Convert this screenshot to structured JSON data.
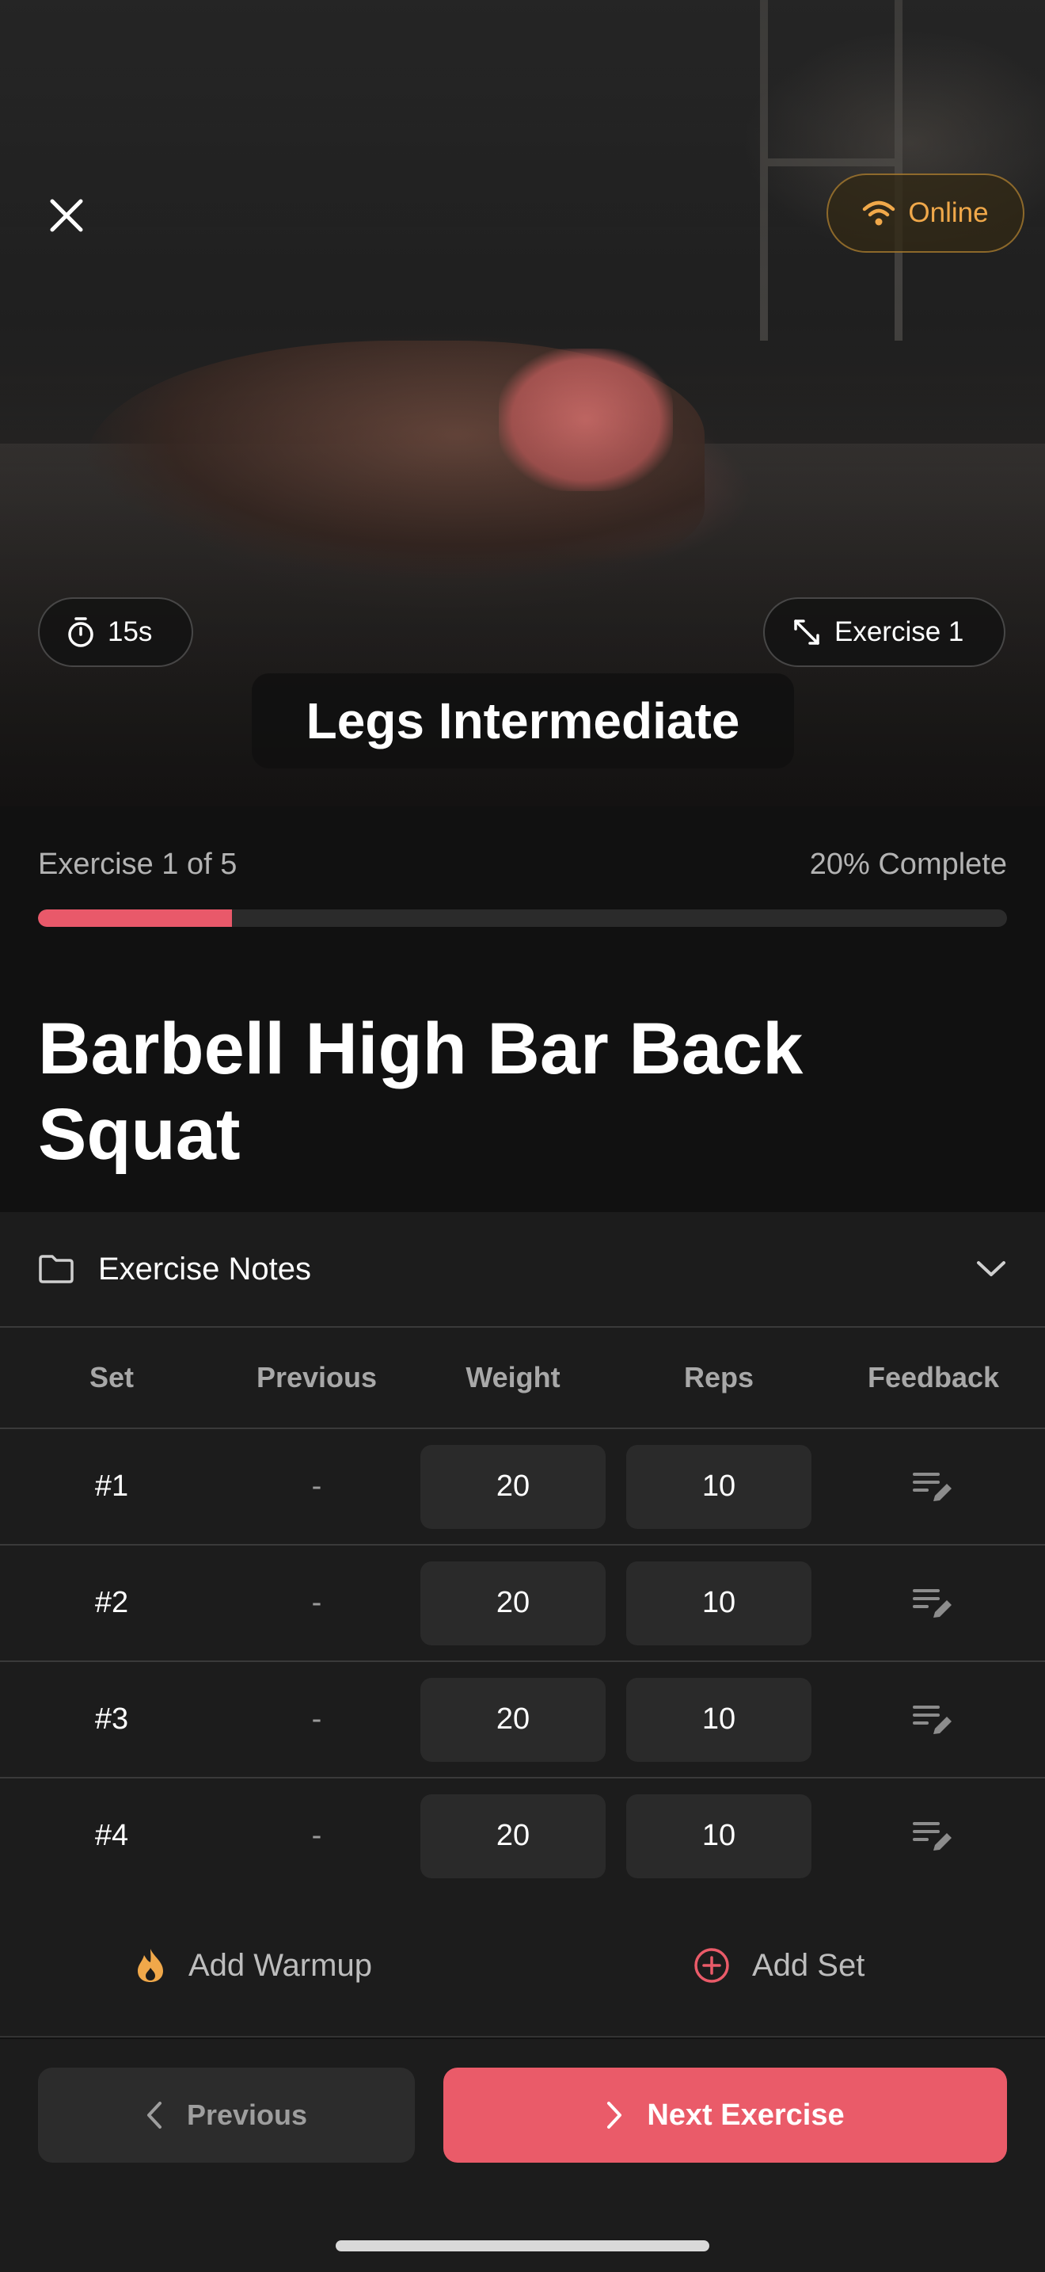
{
  "hero": {
    "status": "Online",
    "timer": "15s",
    "exercise_badge": "Exercise 1",
    "workout_title": "Legs Intermediate"
  },
  "progress": {
    "label": "Exercise 1 of 5",
    "complete_label": "20% Complete",
    "fraction": 0.2
  },
  "exercise": {
    "title": "Barbell High Bar Back Squat"
  },
  "notes": {
    "label": "Exercise Notes"
  },
  "table": {
    "headers": {
      "set": "Set",
      "previous": "Previous",
      "weight": "Weight",
      "reps": "Reps",
      "feedback": "Feedback"
    },
    "rows": [
      {
        "set": "#1",
        "previous": "-",
        "weight": "20",
        "reps": "10"
      },
      {
        "set": "#2",
        "previous": "-",
        "weight": "20",
        "reps": "10"
      },
      {
        "set": "#3",
        "previous": "-",
        "weight": "20",
        "reps": "10"
      },
      {
        "set": "#4",
        "previous": "-",
        "weight": "20",
        "reps": "10"
      }
    ]
  },
  "actions": {
    "warmup": "Add Warmup",
    "add_set": "Add Set"
  },
  "nav": {
    "previous": "Previous",
    "next": "Next Exercise"
  },
  "colors": {
    "accent": "#ea5b69",
    "warning": "#f0a84a"
  },
  "icons": {
    "close": "close-icon",
    "wifi": "wifi-icon",
    "timer": "stopwatch-icon",
    "expand": "expand-icon",
    "notes": "folder-icon",
    "chevron": "chevron-down-icon",
    "feedback": "edit-notes-icon",
    "warmup": "flame-icon",
    "add": "plus-circle-icon"
  }
}
